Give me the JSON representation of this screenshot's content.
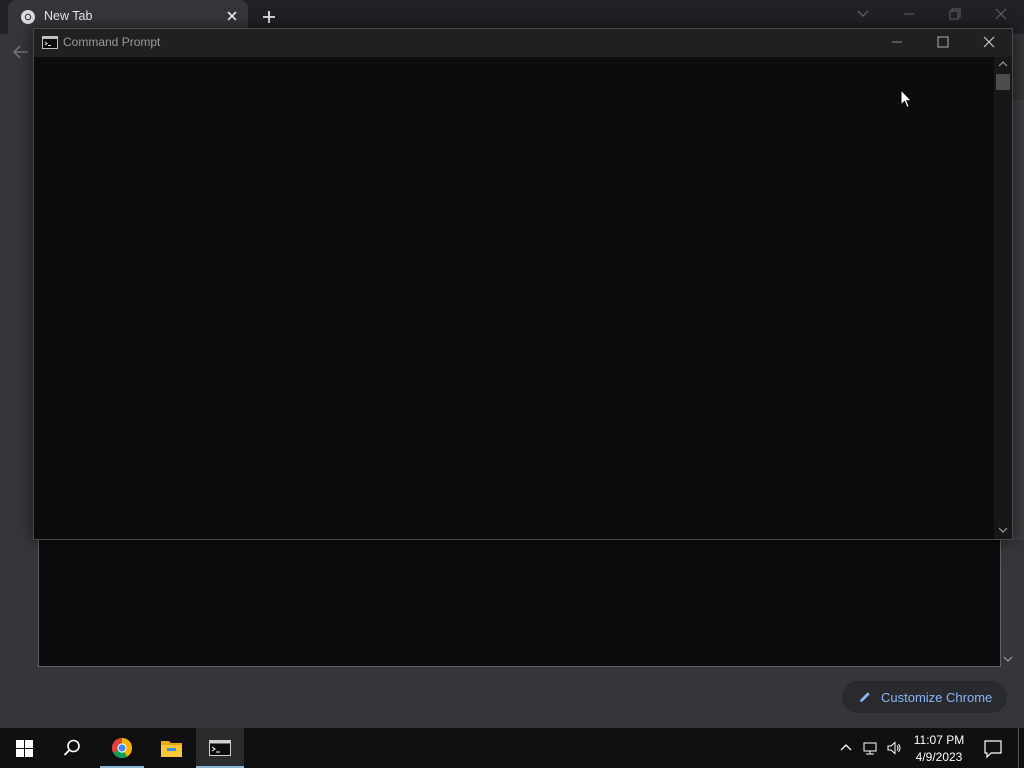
{
  "chrome": {
    "tab_title": "New Tab",
    "customize_label": "Customize Chrome"
  },
  "cmd": {
    "title": "Command Prompt"
  },
  "taskbar": {
    "time": "11:07 PM",
    "date": "4/9/2023",
    "apps": [
      "start-icon",
      "search-icon",
      "chrome-icon",
      "file-explorer-icon",
      "command-prompt-icon"
    ]
  },
  "colors": {
    "accent": "#8ab4f8",
    "console_bg": "#0c0c0c",
    "taskbar_bg": "#101010"
  }
}
